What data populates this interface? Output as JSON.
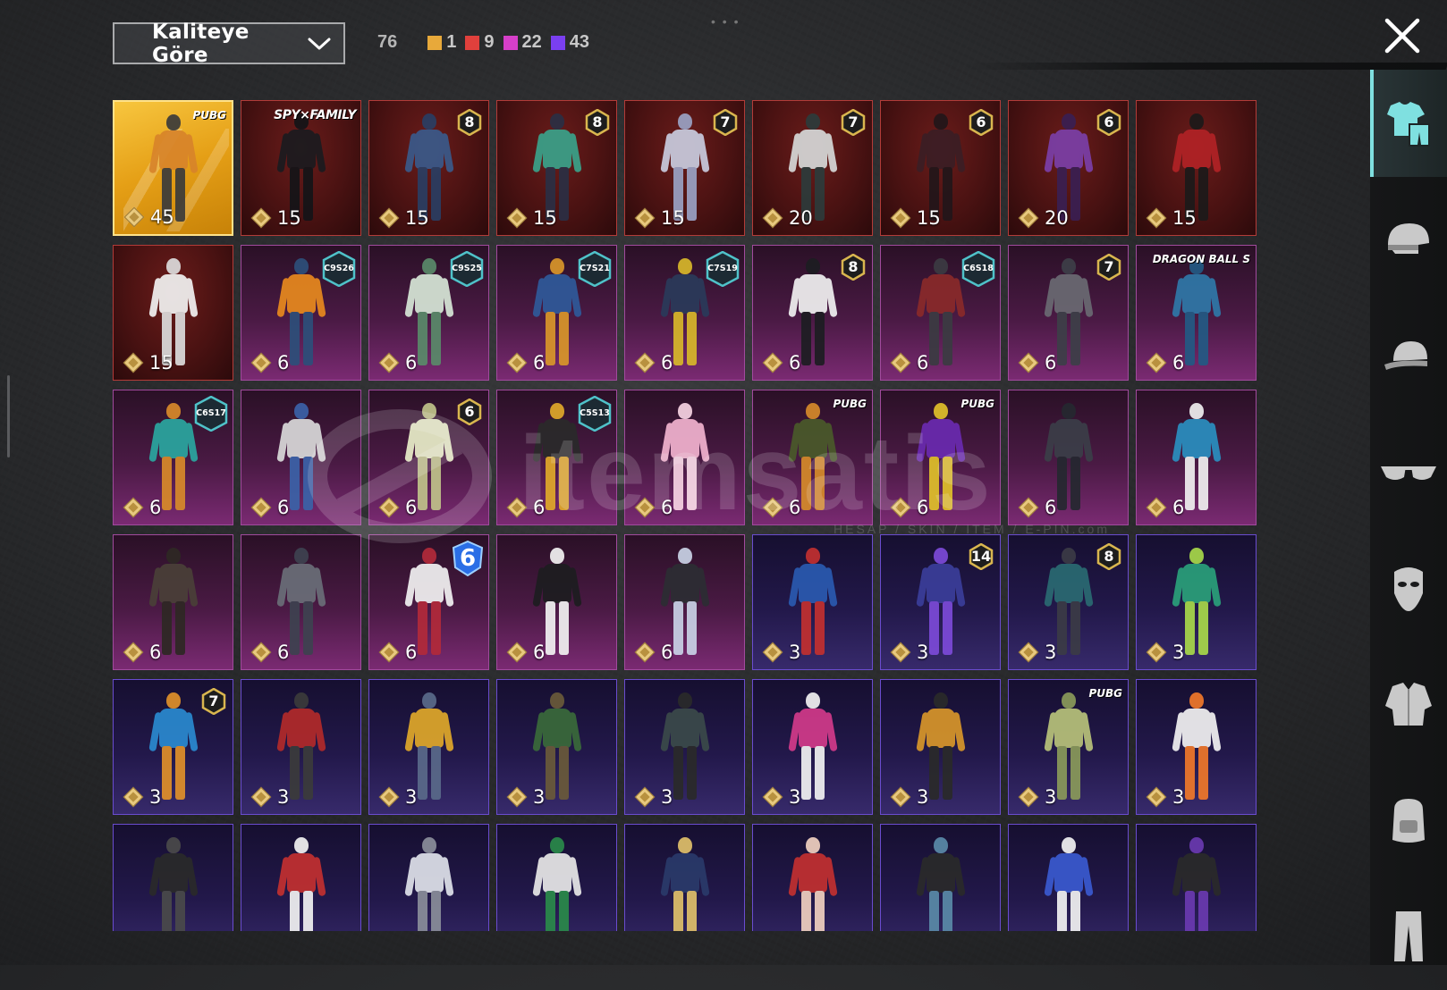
{
  "sort": {
    "label": "Kaliteye Göre"
  },
  "counts": {
    "total": "76",
    "stats": [
      {
        "value": "1",
        "color": "#e8a93a"
      },
      {
        "value": "9",
        "color": "#e0403c"
      },
      {
        "value": "22",
        "color": "#d63fc9"
      },
      {
        "value": "43",
        "color": "#7a3ff0"
      }
    ]
  },
  "watermark": {
    "word": "itemsatis",
    "tag": "HESAP / SKIN / ITEM / E-PIN",
    "suffix": ".com"
  },
  "sidebar": {
    "items": [
      {
        "icon": "outfit-icon",
        "active": true
      },
      {
        "icon": "helmet-icon",
        "active": false
      },
      {
        "icon": "cap-icon",
        "active": false
      },
      {
        "icon": "sunglasses-icon",
        "active": false
      },
      {
        "icon": "mask-icon",
        "active": false
      },
      {
        "icon": "jacket-icon",
        "active": false
      },
      {
        "icon": "backpack-icon",
        "active": false
      },
      {
        "icon": "pants-icon",
        "active": false
      }
    ]
  },
  "cards": [
    {
      "rarity": "gold",
      "price": "45",
      "badge": {
        "type": "brand-sm",
        "text": "PUBG"
      },
      "colors": [
        "#d8842a",
        "#3b3b3b"
      ]
    },
    {
      "rarity": "red",
      "price": "15",
      "badge": {
        "type": "brand",
        "text": "SPY×FAMILY"
      },
      "colors": [
        "#1b1b1f",
        "#141418"
      ]
    },
    {
      "rarity": "red",
      "price": "15",
      "badge": {
        "type": "level",
        "text": "8"
      },
      "colors": [
        "#3a5a8a",
        "#2a3e63"
      ]
    },
    {
      "rarity": "red",
      "price": "15",
      "badge": {
        "type": "level",
        "text": "8"
      },
      "colors": [
        "#3aa28a",
        "#2b2f44"
      ]
    },
    {
      "rarity": "red",
      "price": "15",
      "badge": {
        "type": "level",
        "text": "7"
      },
      "colors": [
        "#c9ccdf",
        "#9aa2c4"
      ]
    },
    {
      "rarity": "red",
      "price": "20",
      "badge": {
        "type": "level",
        "text": "7"
      },
      "colors": [
        "#d6d8d8",
        "#2d3b3b"
      ]
    },
    {
      "rarity": "red",
      "price": "15",
      "badge": {
        "type": "level",
        "text": "6"
      },
      "colors": [
        "#3b1e25",
        "#22161a"
      ]
    },
    {
      "rarity": "red",
      "price": "20",
      "badge": {
        "type": "level",
        "text": "6"
      },
      "colors": [
        "#7b3fa8",
        "#3a1f52"
      ]
    },
    {
      "rarity": "red",
      "price": "15",
      "badge": null,
      "colors": [
        "#b12226",
        "#1c1a1a"
      ]
    },
    {
      "rarity": "red",
      "price": "15",
      "badge": null,
      "colors": [
        "#f2f2f2",
        "#dcdcdc"
      ]
    },
    {
      "rarity": "purple",
      "price": "6",
      "badge": {
        "type": "season",
        "text": "C9S26"
      },
      "colors": [
        "#e8891e",
        "#2d4f7a"
      ]
    },
    {
      "rarity": "purple",
      "price": "6",
      "badge": {
        "type": "season",
        "text": "C9S25"
      },
      "colors": [
        "#d7e7d7",
        "#5a8a6a"
      ]
    },
    {
      "rarity": "purple",
      "price": "6",
      "badge": {
        "type": "season",
        "text": "C7S21"
      },
      "colors": [
        "#2f5a9a",
        "#d9962a"
      ]
    },
    {
      "rarity": "purple",
      "price": "6",
      "badge": {
        "type": "season",
        "text": "C7S19"
      },
      "colors": [
        "#2a3a5a",
        "#d8b72a"
      ]
    },
    {
      "rarity": "purple",
      "price": "6",
      "badge": {
        "type": "level",
        "text": "8"
      },
      "colors": [
        "#f1f1f1",
        "#1d1d22"
      ]
    },
    {
      "rarity": "purple",
      "price": "6",
      "badge": {
        "type": "season",
        "text": "C6S18"
      },
      "colors": [
        "#8a2a2a",
        "#3b3b42"
      ]
    },
    {
      "rarity": "purple",
      "price": "6",
      "badge": {
        "type": "level",
        "text": "7"
      },
      "colors": [
        "#6a6a72",
        "#3d3f48"
      ]
    },
    {
      "rarity": "purple",
      "price": "6",
      "badge": {
        "type": "brand-sm",
        "text": "DRAGON BALL S"
      },
      "colors": [
        "#2f78a8",
        "#235a84"
      ]
    },
    {
      "rarity": "purple",
      "price": "6",
      "badge": {
        "type": "season",
        "text": "C6S17"
      },
      "colors": [
        "#2aa7a0",
        "#d88a2a"
      ]
    },
    {
      "rarity": "purple",
      "price": "6",
      "badge": null,
      "colors": [
        "#d9d9d9",
        "#3b62a8"
      ]
    },
    {
      "rarity": "purple",
      "price": "6",
      "badge": {
        "type": "level",
        "text": "6"
      },
      "colors": [
        "#e9edc9",
        "#c0c28a"
      ]
    },
    {
      "rarity": "purple",
      "price": "6",
      "badge": {
        "type": "season",
        "text": "C5S13"
      },
      "colors": [
        "#2a2a2a",
        "#e0a82a"
      ]
    },
    {
      "rarity": "purple",
      "price": "6",
      "badge": null,
      "colors": [
        "#f2b3cf",
        "#f7d3e3"
      ]
    },
    {
      "rarity": "purple",
      "price": "6",
      "badge": {
        "type": "brand-sm",
        "text": "PUBG"
      },
      "colors": [
        "#4a5a2a",
        "#d58a2a"
      ]
    },
    {
      "rarity": "purple",
      "price": "6",
      "badge": {
        "type": "brand-sm",
        "text": "PUBG"
      },
      "colors": [
        "#6a2ab0",
        "#e0c02a"
      ]
    },
    {
      "rarity": "purple",
      "price": "6",
      "badge": null,
      "colors": [
        "#3b3e48",
        "#252830"
      ]
    },
    {
      "rarity": "purple",
      "price": "6",
      "badge": null,
      "colors": [
        "#2a8fc0",
        "#f0f0f0"
      ]
    },
    {
      "rarity": "purple",
      "price": "6",
      "badge": null,
      "colors": [
        "#4a4038",
        "#2e2824"
      ]
    },
    {
      "rarity": "purple",
      "price": "6",
      "badge": null,
      "colors": [
        "#6a6e78",
        "#3e4250"
      ]
    },
    {
      "rarity": "purple",
      "price": "6",
      "badge": {
        "type": "blue6",
        "text": "6"
      },
      "colors": [
        "#f2f2f2",
        "#b22a3a"
      ]
    },
    {
      "rarity": "purple",
      "price": "6",
      "badge": null,
      "colors": [
        "#1d1d20",
        "#f2f2f2"
      ]
    },
    {
      "rarity": "purple",
      "price": "6",
      "badge": null,
      "colors": [
        "#2c2d33",
        "#c9d2e6"
      ]
    },
    {
      "rarity": "violet",
      "price": "3",
      "badge": null,
      "colors": [
        "#2a5ab0",
        "#c23030"
      ]
    },
    {
      "rarity": "violet",
      "price": "3",
      "badge": {
        "type": "level",
        "text": "14"
      },
      "colors": [
        "#3b3e9a",
        "#7c4ad8"
      ]
    },
    {
      "rarity": "violet",
      "price": "3",
      "badge": {
        "type": "level",
        "text": "8"
      },
      "colors": [
        "#2a6a72",
        "#3b3b46"
      ]
    },
    {
      "rarity": "violet",
      "price": "3",
      "badge": null,
      "colors": [
        "#2aa07a",
        "#a8d84a"
      ]
    },
    {
      "rarity": "violet",
      "price": "3",
      "badge": {
        "type": "level",
        "text": "7"
      },
      "colors": [
        "#2a8ad0",
        "#e0902a"
      ]
    },
    {
      "rarity": "violet",
      "price": "3",
      "badge": null,
      "colors": [
        "#b22a2a",
        "#3b3b3b"
      ]
    },
    {
      "rarity": "violet",
      "price": "3",
      "badge": null,
      "colors": [
        "#e0a82a",
        "#5a6a8a"
      ]
    },
    {
      "rarity": "violet",
      "price": "3",
      "badge": null,
      "colors": [
        "#3a6a3a",
        "#6a5a3a"
      ]
    },
    {
      "rarity": "violet",
      "price": "3",
      "badge": null,
      "colors": [
        "#3b4a4a",
        "#2a2a2a"
      ]
    },
    {
      "rarity": "violet",
      "price": "3",
      "badge": null,
      "colors": [
        "#d23a8a",
        "#f2f2f2"
      ]
    },
    {
      "rarity": "violet",
      "price": "3",
      "badge": null,
      "colors": [
        "#d8962a",
        "#2a2a2a"
      ]
    },
    {
      "rarity": "violet",
      "price": "3",
      "badge": {
        "type": "brand-sm",
        "text": "PUBG"
      },
      "colors": [
        "#b8c27a",
        "#8a9a5a"
      ]
    },
    {
      "rarity": "violet",
      "price": "3",
      "badge": null,
      "colors": [
        "#f2f2f2",
        "#f0782a"
      ]
    },
    {
      "rarity": "violet",
      "price": "",
      "badge": null,
      "colors": [
        "#2a2a2a",
        "#4a4a4a"
      ]
    },
    {
      "rarity": "violet",
      "price": "",
      "badge": null,
      "colors": [
        "#c23030",
        "#f2f2f2"
      ]
    },
    {
      "rarity": "violet",
      "price": "",
      "badge": null,
      "colors": [
        "#dfe2ea",
        "#8a8e9a"
      ]
    },
    {
      "rarity": "violet",
      "price": "",
      "badge": null,
      "colors": [
        "#e8e8e8",
        "#2a8a4a"
      ]
    },
    {
      "rarity": "violet",
      "price": "",
      "badge": null,
      "colors": [
        "#2a3a6a",
        "#e0c06a"
      ]
    },
    {
      "rarity": "violet",
      "price": "",
      "badge": null,
      "colors": [
        "#c23030",
        "#f0d0c0"
      ]
    },
    {
      "rarity": "violet",
      "price": "",
      "badge": null,
      "colors": [
        "#2a2a2a",
        "#5a8aa8"
      ]
    },
    {
      "rarity": "violet",
      "price": "",
      "badge": null,
      "colors": [
        "#3a5ad0",
        "#f2f2f2"
      ]
    },
    {
      "rarity": "violet",
      "price": "",
      "badge": null,
      "colors": [
        "#2a2a2a",
        "#6a3ab0"
      ]
    }
  ]
}
